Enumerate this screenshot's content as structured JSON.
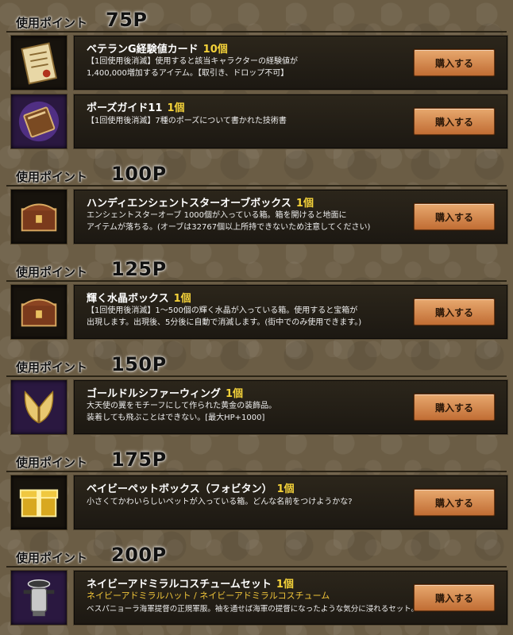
{
  "sections": [
    {
      "label": "使用ポイント",
      "points": "75P",
      "items": [
        {
          "name": "ベテランG経験値カード",
          "qty": "10個",
          "lines": [
            "【1回使用後消滅】使用すると該当キャラクターの経験値が",
            "1,400,000増加するアイテム。【取引き、ドロップ不可】"
          ],
          "icon": "scroll-icon",
          "button": "購入する"
        },
        {
          "name": "ポーズガイド11",
          "qty": "1個",
          "lines": [
            "【1回使用後消滅】7種のポーズについて書かれた技術書"
          ],
          "icon": "book-icon",
          "button": "購入する"
        }
      ]
    },
    {
      "label": "使用ポイント",
      "points": "100P",
      "items": [
        {
          "name": "ハンディエンシェントスターオーブボックス",
          "qty": "1個",
          "lines": [
            "エンシェントスターオーブ 1000個が入っている箱。箱を開けると地面に",
            "アイテムが落ちる。(オーブは32767個以上所持できないため注意してください)"
          ],
          "icon": "chest-icon",
          "button": "購入する"
        }
      ]
    },
    {
      "label": "使用ポイント",
      "points": "125P",
      "items": [
        {
          "name": "輝く水晶ボックス",
          "qty": "1個",
          "lines": [
            "【1回使用後消滅】1～500個の輝く水晶が入っている箱。使用すると宝箱が",
            "出現します。出現後、5分後に自動で消滅します。(街中でのみ使用できます。)"
          ],
          "icon": "chest-icon",
          "button": "購入する"
        }
      ]
    },
    {
      "label": "使用ポイント",
      "points": "150P",
      "items": [
        {
          "name": "ゴールドルシファーウィング",
          "qty": "1個",
          "lines": [
            "大天使の翼をモチーフにして作られた黄金の装飾品。",
            "装着しても飛ぶことはできない。[最大HP+1000]"
          ],
          "icon": "wings-icon",
          "button": "購入する"
        }
      ]
    },
    {
      "label": "使用ポイント",
      "points": "175P",
      "items": [
        {
          "name": "ベイビーペットボックス（フォビタン）",
          "qty": "1個",
          "lines": [
            "小さくてかわいらしいペットが入っている箱。どんな名前をつけようかな?"
          ],
          "icon": "gold-box-icon",
          "button": "購入する"
        }
      ]
    },
    {
      "label": "使用ポイント",
      "points": "200P",
      "items": [
        {
          "name": "ネイビーアドミラルコスチュームセット",
          "qty": "1個",
          "sub": "ネイビーアドミラルハット / ネイビーアドミラルコスチューム",
          "lines": [
            "ベスパニョーラ海軍提督の正規軍服。袖を通せば海軍の提督になったような気分に浸れるセット。"
          ],
          "icon": "admiral-costume-icon",
          "button": "購入する"
        }
      ]
    }
  ]
}
